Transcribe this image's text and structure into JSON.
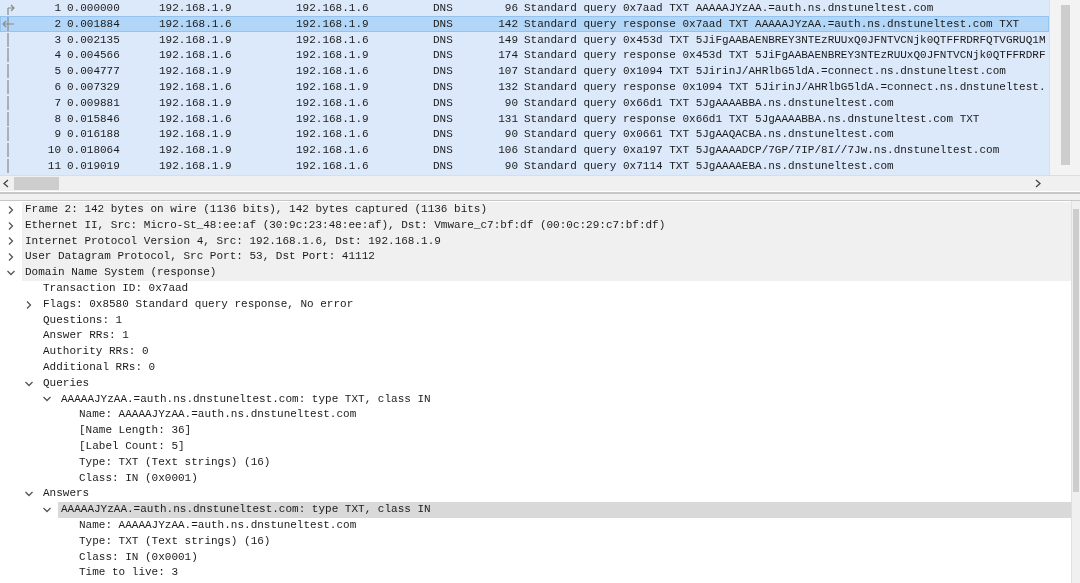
{
  "packet_list": {
    "rows": [
      {
        "no": "1",
        "time": "0.000000",
        "source": "192.168.1.9",
        "destination": "192.168.1.6",
        "protocol": "DNS",
        "length": "96",
        "info": "Standard query 0x7aad TXT AAAAAJYzAA.=auth.ns.dnstuneltest.com",
        "selected": false,
        "kind": "request"
      },
      {
        "no": "2",
        "time": "0.001884",
        "source": "192.168.1.6",
        "destination": "192.168.1.9",
        "protocol": "DNS",
        "length": "142",
        "info": "Standard query response 0x7aad TXT AAAAAJYzAA.=auth.ns.dnstuneltest.com TXT",
        "selected": true,
        "kind": "response"
      },
      {
        "no": "3",
        "time": "0.002135",
        "source": "192.168.1.9",
        "destination": "192.168.1.6",
        "protocol": "DNS",
        "length": "149",
        "info": "Standard query 0x453d TXT 5JiFgAABAENBREY3NTEzRUUxQ0JFNTVCNjk0QTFFRDRFQTVGRUQ1M",
        "selected": false
      },
      {
        "no": "4",
        "time": "0.004566",
        "source": "192.168.1.6",
        "destination": "192.168.1.9",
        "protocol": "DNS",
        "length": "174",
        "info": "Standard query response 0x453d TXT 5JiFgAABAENBREY3NTEzRUUxQ0JFNTVCNjk0QTFFRDRF",
        "selected": false
      },
      {
        "no": "5",
        "time": "0.004777",
        "source": "192.168.1.9",
        "destination": "192.168.1.6",
        "protocol": "DNS",
        "length": "107",
        "info": "Standard query 0x1094 TXT 5JirinJ/AHRlbG5ldA.=connect.ns.dnstuneltest.com",
        "selected": false
      },
      {
        "no": "6",
        "time": "0.007329",
        "source": "192.168.1.6",
        "destination": "192.168.1.9",
        "protocol": "DNS",
        "length": "132",
        "info": "Standard query response 0x1094 TXT 5JirinJ/AHRlbG5ldA.=connect.ns.dnstuneltest.",
        "selected": false
      },
      {
        "no": "7",
        "time": "0.009881",
        "source": "192.168.1.9",
        "destination": "192.168.1.6",
        "protocol": "DNS",
        "length": "90",
        "info": "Standard query 0x66d1 TXT 5JgAAAABBA.ns.dnstuneltest.com",
        "selected": false
      },
      {
        "no": "8",
        "time": "0.015846",
        "source": "192.168.1.6",
        "destination": "192.168.1.9",
        "protocol": "DNS",
        "length": "131",
        "info": "Standard query response 0x66d1 TXT 5JgAAAABBA.ns.dnstuneltest.com TXT",
        "selected": false
      },
      {
        "no": "9",
        "time": "0.016188",
        "source": "192.168.1.9",
        "destination": "192.168.1.6",
        "protocol": "DNS",
        "length": "90",
        "info": "Standard query 0x0661 TXT 5JgAAQACBA.ns.dnstuneltest.com",
        "selected": false
      },
      {
        "no": "10",
        "time": "0.018064",
        "source": "192.168.1.9",
        "destination": "192.168.1.6",
        "protocol": "DNS",
        "length": "106",
        "info": "Standard query 0xa197 TXT 5JgAAAADCP/7GP/7IP/8I//7Jw.ns.dnstuneltest.com",
        "selected": false
      },
      {
        "no": "11",
        "time": "0.019019",
        "source": "192.168.1.9",
        "destination": "192.168.1.6",
        "protocol": "DNS",
        "length": "90",
        "info": "Standard query 0x7114 TXT 5JgAAAAEBA.ns.dnstuneltest.com",
        "selected": false
      }
    ]
  },
  "details": {
    "nodes": [
      {
        "text": "Frame 2: 142 bytes on wire (1136 bits), 142 bytes captured (1136 bits)",
        "kind": "branch",
        "expanded": false,
        "selected": false
      },
      {
        "text": "Ethernet II, Src: Micro-St_48:ee:af (30:9c:23:48:ee:af), Dst: Vmware_c7:bf:df (00:0c:29:c7:bf:df)",
        "kind": "branch",
        "expanded": false,
        "selected": false
      },
      {
        "text": "Internet Protocol Version 4, Src: 192.168.1.6, Dst: 192.168.1.9",
        "kind": "branch",
        "expanded": false,
        "selected": false
      },
      {
        "text": "User Datagram Protocol, Src Port: 53, Dst Port: 41112",
        "kind": "branch",
        "expanded": false,
        "selected": false
      },
      {
        "text": "Domain Name System (response)",
        "kind": "branch",
        "expanded": true,
        "selected": false,
        "children": [
          {
            "text": "Transaction ID: 0x7aad",
            "kind": "leaf",
            "selected": false
          },
          {
            "text": "Flags: 0x8580 Standard query response, No error",
            "kind": "branch",
            "expanded": false,
            "selected": false
          },
          {
            "text": "Questions: 1",
            "kind": "leaf",
            "selected": false
          },
          {
            "text": "Answer RRs: 1",
            "kind": "leaf",
            "selected": false
          },
          {
            "text": "Authority RRs: 0",
            "kind": "leaf",
            "selected": false
          },
          {
            "text": "Additional RRs: 0",
            "kind": "leaf",
            "selected": false
          },
          {
            "text": "Queries",
            "kind": "branch",
            "expanded": true,
            "selected": false,
            "children": [
              {
                "text": "AAAAAJYzAA.=auth.ns.dnstuneltest.com: type TXT, class IN",
                "kind": "branch",
                "expanded": true,
                "selected": false,
                "children": [
                  {
                    "text": "Name: AAAAAJYzAA.=auth.ns.dnstuneltest.com",
                    "kind": "leaf",
                    "selected": false
                  },
                  {
                    "text": "[Name Length: 36]",
                    "kind": "leaf",
                    "selected": false
                  },
                  {
                    "text": "[Label Count: 5]",
                    "kind": "leaf",
                    "selected": false
                  },
                  {
                    "text": "Type: TXT (Text strings) (16)",
                    "kind": "leaf",
                    "selected": false
                  },
                  {
                    "text": "Class: IN (0x0001)",
                    "kind": "leaf",
                    "selected": false
                  }
                ]
              }
            ]
          },
          {
            "text": "Answers",
            "kind": "branch",
            "expanded": true,
            "selected": false,
            "children": [
              {
                "text": "AAAAAJYzAA.=auth.ns.dnstuneltest.com: type TXT, class IN",
                "kind": "branch",
                "expanded": true,
                "selected": true,
                "children": [
                  {
                    "text": "Name: AAAAAJYzAA.=auth.ns.dnstuneltest.com",
                    "kind": "leaf",
                    "selected": false
                  },
                  {
                    "text": "Type: TXT (Text strings) (16)",
                    "kind": "leaf",
                    "selected": false
                  },
                  {
                    "text": "Class: IN (0x0001)",
                    "kind": "leaf",
                    "selected": false
                  },
                  {
                    "text": "Time to live: 3",
                    "kind": "leaf",
                    "selected": false
                  }
                ]
              }
            ]
          }
        ]
      }
    ]
  }
}
